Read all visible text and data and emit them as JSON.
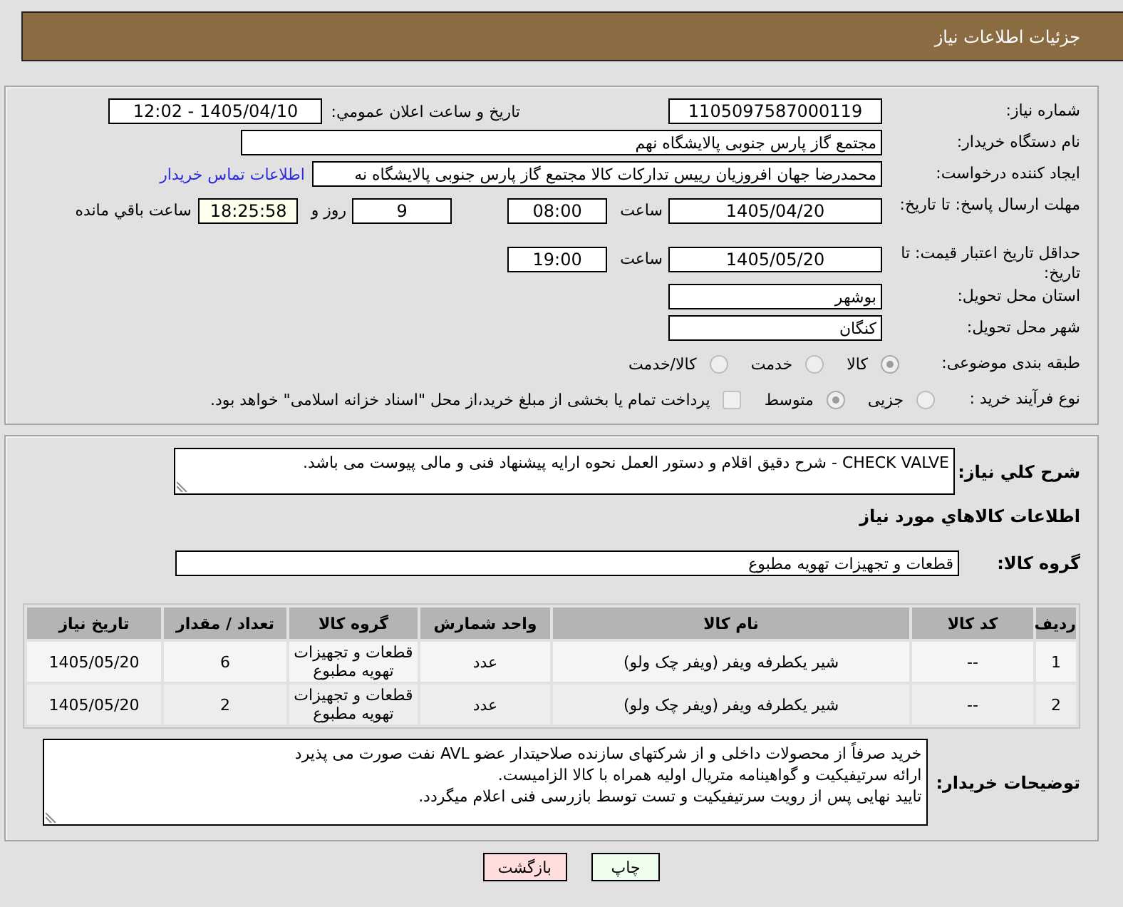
{
  "header": {
    "title": "جزئیات اطلاعات نیاز"
  },
  "details": {
    "need_number": {
      "label": "شماره نیاز:",
      "value": "1105097587000119"
    },
    "announcement": {
      "label": "تاریخ و ساعت اعلان عمومي:",
      "value": "1405/04/10 - 12:02"
    },
    "buyer_org": {
      "label": "نام دستگاه خریدار:",
      "value": "مجتمع گاز پارس جنوبی  پالایشگاه نهم"
    },
    "requester": {
      "label": "ایجاد کننده درخواست:",
      "value": "محمدرضا جهان افروزیان رییس تدارکات کالا مجتمع گاز پارس جنوبی  پالایشگاه نه",
      "link": "اطلاعات تماس خریدار"
    },
    "reply_deadline": {
      "label": "مهلت ارسال پاسخ: تا تاریخ:",
      "date": "1405/04/20",
      "time_label": "ساعت",
      "time": "08:00",
      "days": "9",
      "days_label": "روز و",
      "remaining": "18:25:58",
      "remaining_label": "ساعت باقي مانده"
    },
    "price_validity": {
      "label": "حداقل تاریخ اعتبار قیمت: تا تاریخ:",
      "date": "1405/05/20",
      "time_label": "ساعت",
      "time": "19:00"
    },
    "province": {
      "label": "استان محل تحویل:",
      "value": "بوشهر"
    },
    "city": {
      "label": "شهر محل تحویل:",
      "value": "کنگان"
    },
    "category": {
      "label": "طبقه بندی موضوعی:",
      "options": [
        {
          "label": "کالا",
          "selected": true
        },
        {
          "label": "خدمت",
          "selected": false
        },
        {
          "label": "کالا/خدمت",
          "selected": false
        }
      ]
    },
    "process": {
      "label": "نوع فرآیند خرید :",
      "options": [
        {
          "label": "جزیی",
          "selected": false
        },
        {
          "label": "متوسط",
          "selected": true
        }
      ],
      "treasury": {
        "label": "پرداخت تمام یا بخشی از مبلغ خرید،از محل \"اسناد خزانه اسلامی\" خواهد بود.",
        "checked": false
      }
    }
  },
  "need": {
    "description": {
      "label": "شرح کلي نیاز:",
      "value": "CHECK VALVE - شرح دقیق اقلام و دستور العمل نحوه ارایه پیشنهاد فنی و مالی پیوست می باشد."
    },
    "items_title": "اطلاعات کالاهاي مورد نیاز",
    "goods_group": {
      "label": "گروه کالا:",
      "value": "قطعات و تجهیزات تهویه مطبوع"
    },
    "table": {
      "columns": [
        "ردیف",
        "کد کالا",
        "نام کالا",
        "واحد شمارش",
        "گروه کالا",
        "تعداد / مقدار",
        "تاریخ نیاز"
      ],
      "rows": [
        [
          "1",
          "--",
          "شیر یکطرفه ویفر (ویفر چک ولو)",
          "عدد",
          "قطعات و تجهیزات تهویه مطبوع",
          "6",
          "1405/05/20"
        ],
        [
          "2",
          "--",
          "شیر یکطرفه ویفر (ویفر چک ولو)",
          "عدد",
          "قطعات و تجهیزات تهویه مطبوع",
          "2",
          "1405/05/20"
        ]
      ]
    },
    "buyer_notes": {
      "label": "توضیحات خریدار:",
      "lines": [
        "خرید صرفاً از محصولات داخلی و از شرکتهای سازنده صلاحیتدار عضو AVL نفت صورت می پذیرد",
        "ارائه سرتیفیکیت و گواهینامه متریال اولیه همراه با کالا الزامیست.",
        "تایید نهایی پس از رویت سرتیفیکیت و تست توسط بازرسی فنی اعلام میگردد."
      ]
    }
  },
  "buttons": [
    {
      "label": "چاپ",
      "kind": "print"
    },
    {
      "label": "بازگشت",
      "kind": "back"
    }
  ]
}
